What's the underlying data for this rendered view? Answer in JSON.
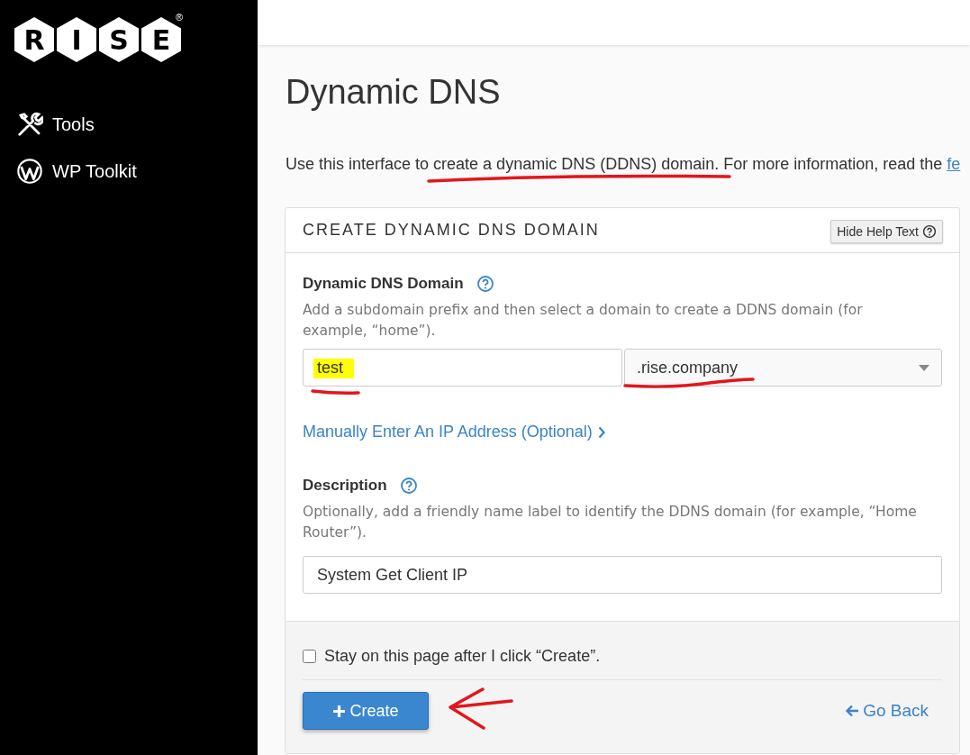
{
  "logo": {
    "letters": [
      "R",
      "I",
      "S",
      "E"
    ],
    "registered": "®"
  },
  "sidebar": {
    "items": [
      {
        "label": "Tools",
        "kind": "tools"
      },
      {
        "label": "WP Toolkit",
        "kind": "wp"
      }
    ]
  },
  "page": {
    "title": "Dynamic DNS",
    "intro": "Use this interface to create a dynamic DNS (DDNS) domain. For more information, read the",
    "intro_link": "fe"
  },
  "panel": {
    "title": "CREATE DYNAMIC DNS DOMAIN",
    "help_toggle": "Hide Help Text",
    "domain": {
      "label": "Dynamic DNS Domain",
      "help": "Add a subdomain prefix and then select a domain to create a DDNS domain (for example, “home”).",
      "prefix": "test",
      "domain": ".rise.company"
    },
    "ip_link": "Manually Enter An IP Address (Optional)",
    "description": {
      "label": "Description",
      "help": "Optionally, add a friendly name label to identify the DDNS domain (for example, “Home Router”).",
      "value": "System Get Client IP"
    },
    "stay_checkbox": {
      "label": "Stay on this page after I click “Create”.",
      "checked": false
    },
    "create_button": "Create",
    "back_link": "Go Back"
  }
}
